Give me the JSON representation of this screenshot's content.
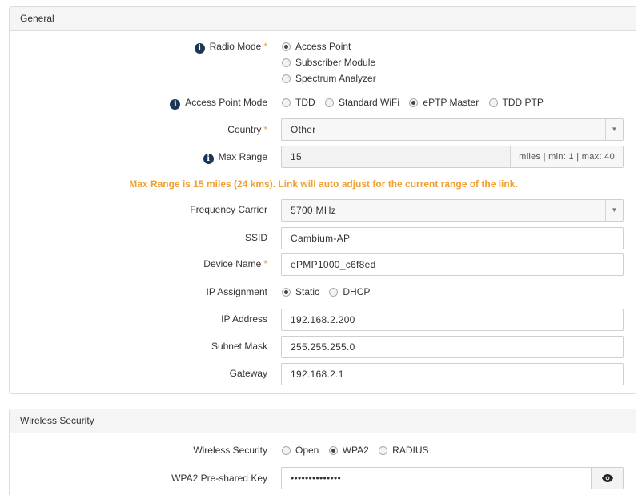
{
  "general": {
    "title": "General",
    "radio_mode": {
      "label": "Radio Mode",
      "required": "*",
      "options": [
        "Access Point",
        "Subscriber Module",
        "Spectrum Analyzer"
      ],
      "selected": "Access Point"
    },
    "ap_mode": {
      "label": "Access Point Mode",
      "options": [
        "TDD",
        "Standard WiFi",
        "ePTP Master",
        "TDD PTP"
      ],
      "selected": "ePTP Master"
    },
    "country": {
      "label": "Country",
      "required": "*",
      "value": "Other"
    },
    "max_range": {
      "label": "Max Range",
      "value": "15",
      "suffix": "miles | min: 1 | max: 40"
    },
    "warning": "Max Range is 15 miles (24 kms). Link will auto adjust for the current range of the link.",
    "frequency": {
      "label": "Frequency Carrier",
      "value": "5700 MHz"
    },
    "ssid": {
      "label": "SSID",
      "value": "Cambium-AP"
    },
    "device_name": {
      "label": "Device Name",
      "required": "*",
      "value": "ePMP1000_c6f8ed"
    },
    "ip_assignment": {
      "label": "IP Assignment",
      "options": [
        "Static",
        "DHCP"
      ],
      "selected": "Static"
    },
    "ip_address": {
      "label": "IP Address",
      "value": "192.168.2.200"
    },
    "subnet_mask": {
      "label": "Subnet Mask",
      "value": "255.255.255.0"
    },
    "gateway": {
      "label": "Gateway",
      "value": "192.168.2.1"
    }
  },
  "wireless": {
    "title": "Wireless Security",
    "security": {
      "label": "Wireless Security",
      "options": [
        "Open",
        "WPA2",
        "RADIUS"
      ],
      "selected": "WPA2"
    },
    "psk": {
      "label": "WPA2 Pre-shared Key",
      "value": "••••••••••••••"
    }
  },
  "icons": {
    "info": "info-icon",
    "select": "chevron-down-icon",
    "show_password": "eye-icon"
  },
  "colors": {
    "required": "#f0a030",
    "warning": "#f0a030",
    "info_badge": "#1a3656"
  }
}
